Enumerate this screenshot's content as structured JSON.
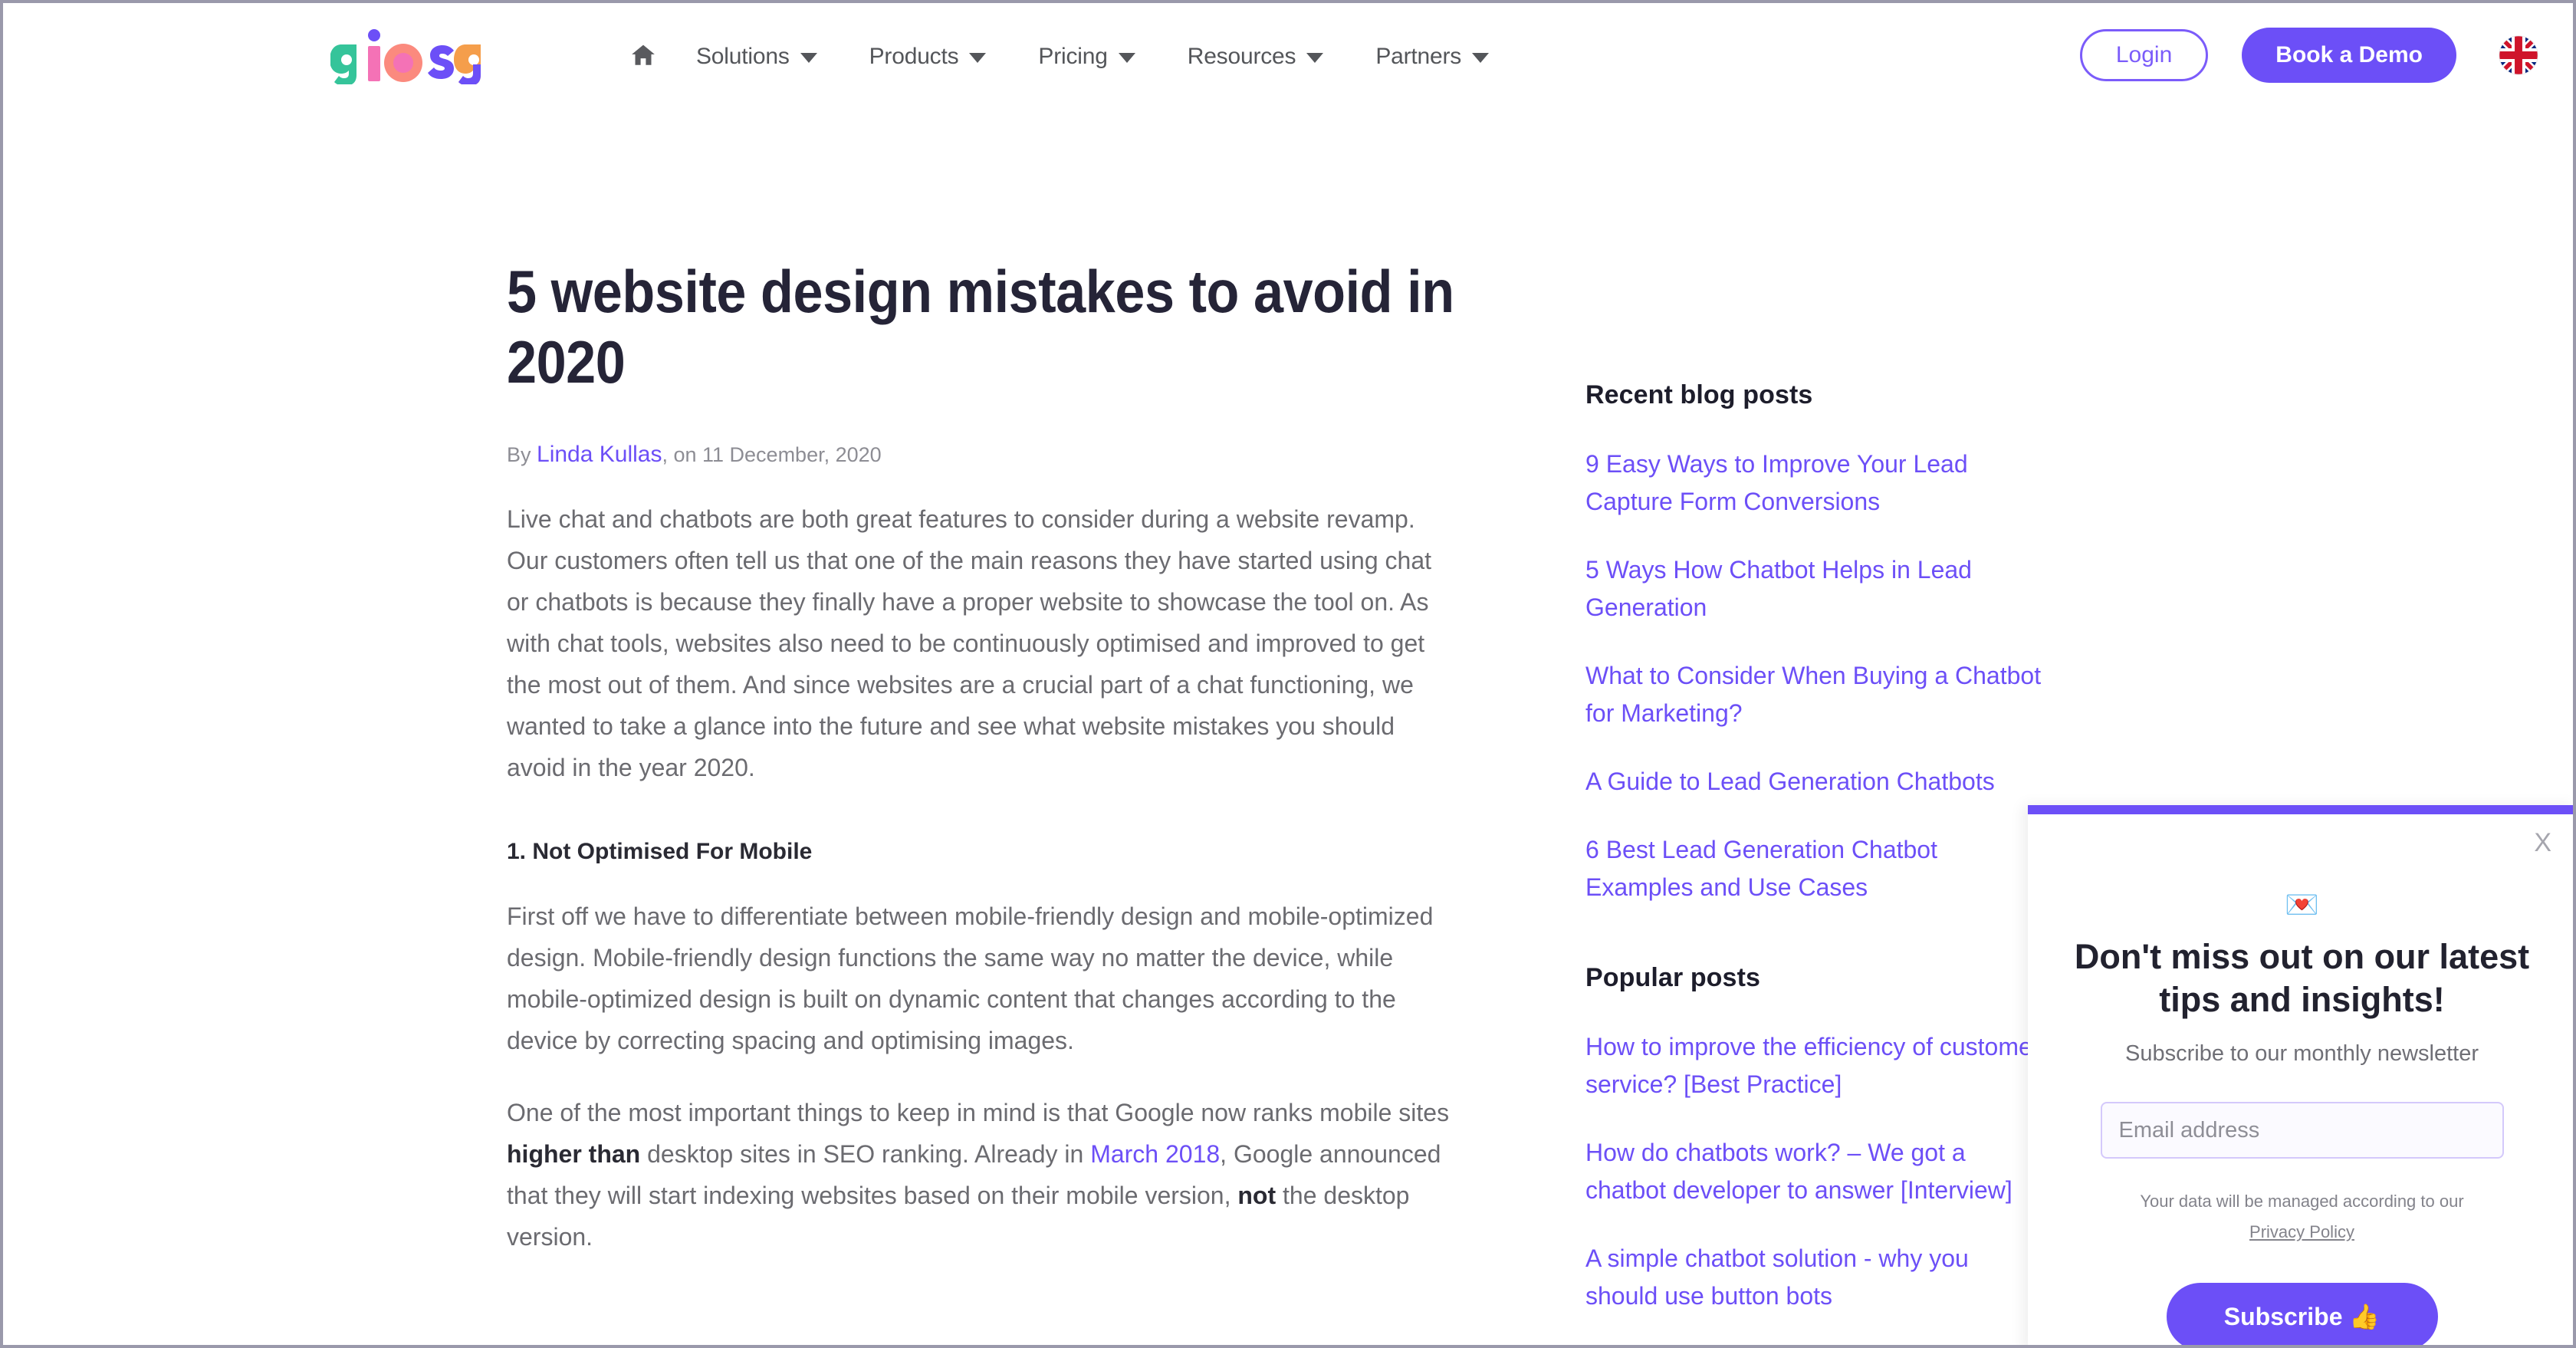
{
  "brand": {
    "logo_text": "giosg",
    "accent": "#6c4ff7",
    "title_color": "#252437",
    "body_color": "#6b6b70"
  },
  "header": {
    "home_icon": "home-icon",
    "nav_items": [
      {
        "label": "Solutions",
        "has_dropdown": true
      },
      {
        "label": "Products",
        "has_dropdown": true
      },
      {
        "label": "Pricing",
        "has_dropdown": true
      },
      {
        "label": "Resources",
        "has_dropdown": true
      },
      {
        "label": "Partners",
        "has_dropdown": true
      }
    ],
    "login_label": "Login",
    "demo_label": "Book a Demo",
    "language_flag": "uk-flag-icon"
  },
  "article": {
    "title": "5 website design mistakes to avoid in 2020",
    "byline_prefix": "By ",
    "author": "Linda Kullas",
    "byline_suffix": ", on 11 December, 2020",
    "paragraph_1": "Live chat and chatbots are both great features to consider during a website revamp. Our customers often tell us that one of the main reasons they have started using chat or chatbots is because they finally have a proper website to showcase the tool on. As with chat tools, websites also need to be continuously optimised and improved to get the most out of them. And since websites are a crucial part of a chat functioning, we wanted to take a glance into the future and see what website mistakes you should avoid in the year 2020.",
    "subheading_1": "1. Not Optimised For Mobile",
    "paragraph_2": "First off we have to differentiate between mobile-friendly design and mobile-optimized design. Mobile-friendly design functions the same way no matter the device, while mobile-optimized design is built on dynamic content that changes according to the device by correcting spacing and optimising images.",
    "paragraph_3": {
      "part_1": "One of the most important things to keep in mind is that Google now ranks mobile sites ",
      "bold_1": "higher than",
      "part_2": " desktop sites in SEO ranking. Already in ",
      "link_1": "March 2018",
      "part_3": ", Google announced that they will start indexing websites based on their mobile version, ",
      "bold_2": "not",
      "part_4": " the desktop version."
    }
  },
  "sidebar": {
    "recent_heading": "Recent blog posts",
    "recent_posts": [
      "9 Easy Ways to Improve Your Lead Capture Form Conversions",
      "5 Ways How Chatbot Helps in Lead Generation",
      "What to Consider When Buying a Chatbot for Marketing?",
      "A Guide to Lead Generation Chatbots",
      "6 Best Lead Generation Chatbot Examples and Use Cases"
    ],
    "popular_heading": "Popular posts",
    "popular_posts": [
      "How to improve the efficiency of customer service? [Best Practice]",
      "How do chatbots work? – We got a chatbot developer to answer [Interview]",
      "A simple chatbot solution - why you should use button bots"
    ]
  },
  "popup": {
    "close_label": "X",
    "emoji": "💌",
    "emoji_name": "love-letter-icon",
    "title": "Don't miss out on our latest tips and insights!",
    "subtitle": "Subscribe to our monthly newsletter",
    "email_placeholder": "Email address",
    "email_value": "",
    "fineprint": "Your data will be managed according to our",
    "privacy_label": "Privacy Policy",
    "subscribe_label": "Subscribe 👍"
  }
}
